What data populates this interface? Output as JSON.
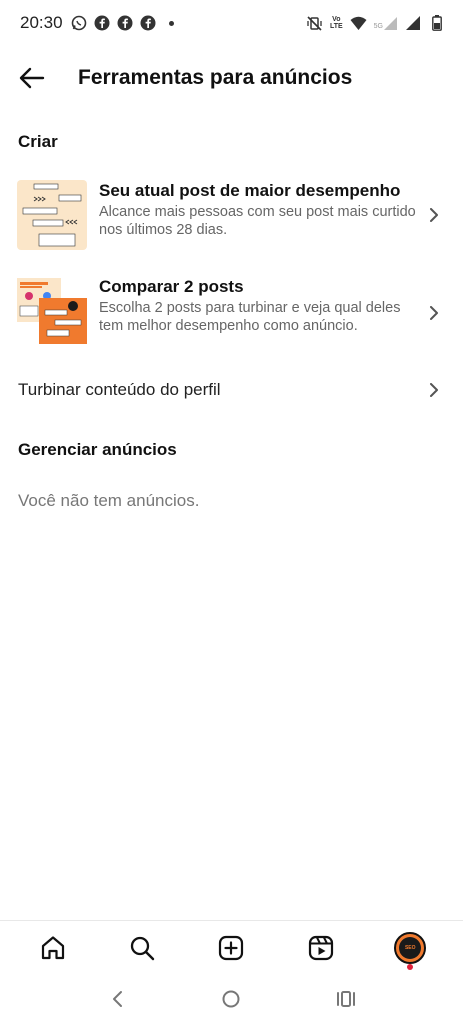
{
  "status_bar": {
    "time": "20:30",
    "lte_line1": "Vo",
    "lte_line2": "LTE",
    "network_type": "5G"
  },
  "header": {
    "title": "Ferramentas para anúncios"
  },
  "sections": {
    "create_title": "Criar",
    "manage_title": "Gerenciar anúncios"
  },
  "items": [
    {
      "title": "Seu atual post de maior desempenho",
      "description": "Alcance mais pessoas com seu post mais curtido nos últimos 28 dias."
    },
    {
      "title": "Comparar 2 posts",
      "description": "Escolha 2 posts para turbinar e veja qual deles tem melhor desempenho como anúncio."
    }
  ],
  "boost_profile_label": "Turbinar conteúdo do perfil",
  "empty_ads_message": "Você não tem anúncios.",
  "avatar_text": "SEO",
  "colors": {
    "accent_orange": "#f07a2e",
    "thumb_bg": "#fbe6c9",
    "notif_red": "#e0213a"
  },
  "icons": {
    "back": "arrow-left-icon",
    "chevron": "chevron-right-icon",
    "home": "home-icon",
    "search": "search-icon",
    "create": "plus-square-icon",
    "reels": "reels-icon"
  }
}
